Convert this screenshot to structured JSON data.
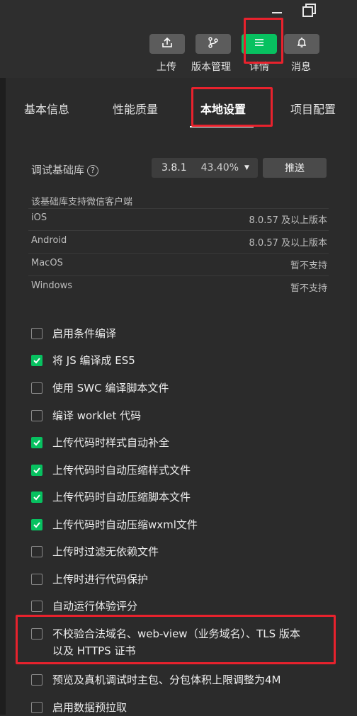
{
  "window": {
    "minimize_icon": "minus-icon",
    "restore_icon": "restore-icon"
  },
  "toolbar": {
    "upload_label": "上传",
    "version_label": "版本管理",
    "details_label": "详情",
    "messages_label": "消息"
  },
  "tabs": [
    {
      "label": "基本信息"
    },
    {
      "label": "性能质量"
    },
    {
      "label": "本地设置",
      "active": true
    },
    {
      "label": "项目配置"
    }
  ],
  "debug": {
    "label": "调试基础库",
    "help": "?",
    "version": "3.8.1",
    "percent": "43.40%",
    "push_label": "推送"
  },
  "clients": {
    "caption": "该基础库支持微信客户端",
    "rows": [
      {
        "name": "iOS",
        "value": "8.0.57 及以上版本"
      },
      {
        "name": "Android",
        "value": "8.0.57 及以上版本"
      },
      {
        "name": "MacOS",
        "value": "暂不支持"
      },
      {
        "name": "Windows",
        "value": "暂不支持"
      }
    ]
  },
  "options": [
    {
      "label": "启用条件编译",
      "checked": false
    },
    {
      "label": "将 JS 编译成 ES5",
      "checked": true
    },
    {
      "label": "使用 SWC 编译脚本文件",
      "checked": false
    },
    {
      "label": "编译 worklet 代码",
      "checked": false
    },
    {
      "label": "上传代码时样式自动补全",
      "checked": true
    },
    {
      "label": "上传代码时自动压缩样式文件",
      "checked": true
    },
    {
      "label": "上传代码时自动压缩脚本文件",
      "checked": true
    },
    {
      "label": "上传代码时自动压缩wxml文件",
      "checked": true
    },
    {
      "label": "上传时过滤无依赖文件",
      "checked": false
    },
    {
      "label": "上传时进行代码保护",
      "checked": false
    },
    {
      "label": "自动运行体验评分",
      "checked": false
    },
    {
      "label": "不校验合法域名、web-view（业务域名）、TLS 版本以及 HTTPS 证书",
      "checked": false
    },
    {
      "label": "预览及真机调试时主包、分包体积上限调整为4M",
      "checked": false
    },
    {
      "label": "启用数据预拉取",
      "checked": false
    }
  ],
  "colors": {
    "accent": "#07c160",
    "highlight": "#e8222d",
    "background": "#2b2b2b"
  }
}
